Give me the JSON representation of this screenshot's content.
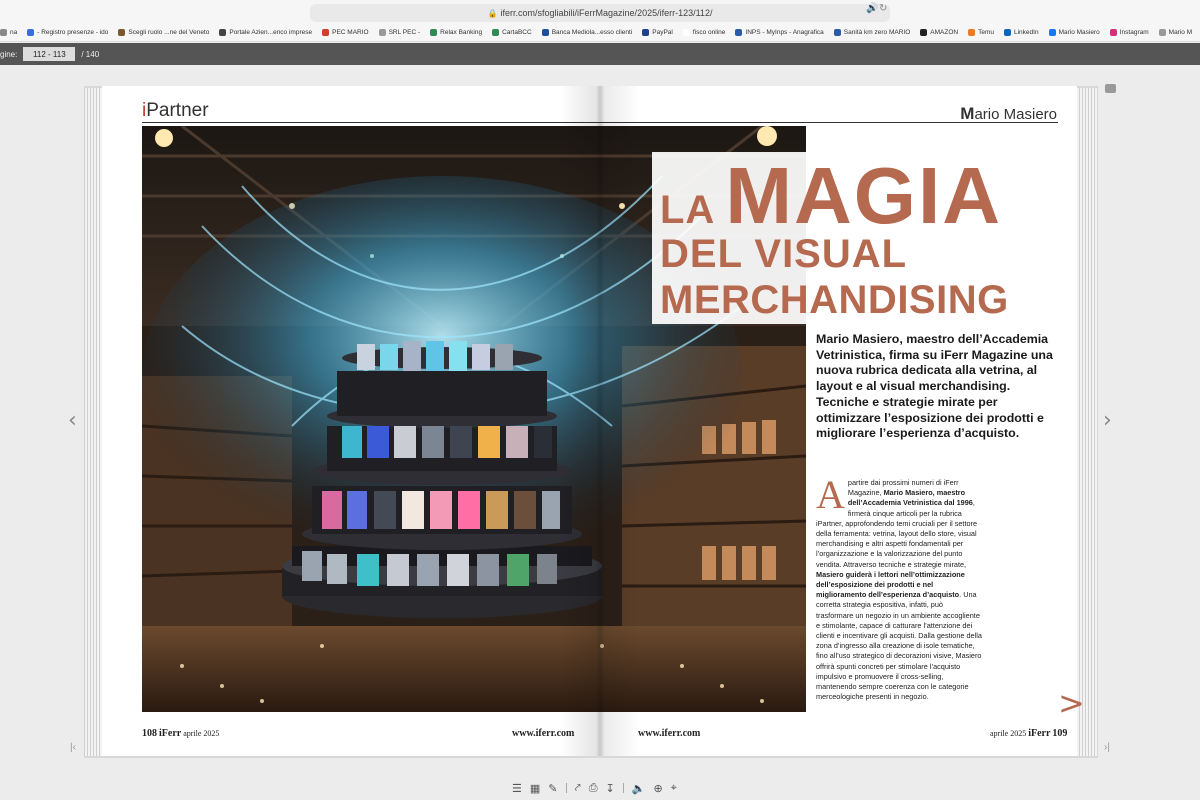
{
  "browser": {
    "url": "iferr.com/sfogliabili/iFerrMagazine/2025/iferr-123/112/",
    "bookmarks": [
      {
        "label": "na",
        "color": "#888888"
      },
      {
        "label": "- Registro presenze - ido",
        "color": "#3a6fd8"
      },
      {
        "label": "Scegli ruolo ...ne del Veneto",
        "color": "#7a5a2a"
      },
      {
        "label": "Portale Azien...enco imprese",
        "color": "#444444"
      },
      {
        "label": "PEC MARIO",
        "color": "#d63b2b"
      },
      {
        "label": "SRL PEC -",
        "color": "#999999"
      },
      {
        "label": "Relax Banking",
        "color": "#2e8b57"
      },
      {
        "label": "CartaBCC",
        "color": "#2e8b57"
      },
      {
        "label": "Banca Mediola...esso clienti",
        "color": "#1f4e9c"
      },
      {
        "label": "PayPal",
        "color": "#1f3f8f"
      },
      {
        "label": "fisco online",
        "color": "#ffffff"
      },
      {
        "label": "INPS - MyInps - Anagrafica",
        "color": "#2a5caa"
      },
      {
        "label": "Sanità km zero MARIO",
        "color": "#2a5caa"
      },
      {
        "label": "AMAZON",
        "color": "#222222"
      },
      {
        "label": "Temu",
        "color": "#f07a23"
      },
      {
        "label": "LinkedIn",
        "color": "#0a66c2"
      },
      {
        "label": "Mario Masiero",
        "color": "#1877f2"
      },
      {
        "label": "Instagram",
        "color": "#d6307a"
      },
      {
        "label": "Mario M",
        "color": "#999999"
      }
    ]
  },
  "viewer": {
    "page_label": "gine:",
    "page_value": "112 - 113",
    "page_total": "/ 140"
  },
  "magazine": {
    "brand_i": "i",
    "brand_rest": "Partner",
    "author_first_letter": "M",
    "author_rest": "ario Masiero",
    "title_la": "LA",
    "title_magia": "MAGIA",
    "title_line2": "DEL VISUAL",
    "title_line3": "MERCHANDISING",
    "lead": "Mario Masiero, maestro dell’Accademia Vetrinistica, firma su iFerr Magazine una nuova rubrica dedicata alla vetrina, al layout e al visual merchandising. Tecniche e strategie mirate per ottimizzare l’esposizione dei prodotti e migliorare l’esperienza d’acquisto.",
    "dropcap": "A",
    "body_1": "partire dai prossimi numeri di iFerr Magazine, ",
    "body_1b": "Mario Masiero, maestro dell’Accademia Vetrinistica dal 1996",
    "body_2": ", firmerà cinque articoli per la rubrica iPartner, approfondendo temi cruciali per il settore della ferramenta: vetrina, layout dello store, visual merchandising e altri aspetti fondamentali per l’organizzazione e la valorizzazione del punto vendita. Attraverso tecniche e strategie mirate, ",
    "body_2b": "Masiero guiderà i lettori nell’ottimizzazione dell’esposizione dei prodotti e nel miglioramento dell’esperienza d’acquisto",
    "body_3": ". Una corretta strategia espositiva, infatti, può trasformare un negozio in un ambiente accogliente e stimolante, capace di catturare l’attenzione dei clienti e incentivare gli acquisti. Dalla gestione della zona d’ingresso alla creazione di isole tematiche, fino all’uso strategico di decorazioni visive, Masiero offrirà spunti concreti per stimolare l’acquisto impulsivo e promuovere il cross-selling, mantenendo sempre coerenza con le categorie merceologiche presenti in negozio.",
    "next_arrow": ">",
    "folio_left_num": "108",
    "folio_left_brand": "iFerr",
    "folio_left_date": "aprile 2025",
    "folio_left_url": "www.iferr.com",
    "folio_right_url": "www.iferr.com",
    "folio_right_date": "aprile 2025",
    "folio_right_brand": "iFerr",
    "folio_right_num": "109"
  },
  "colors": {
    "title": "#b5694f",
    "viewer_bar": "#555555",
    "background": "#ececec"
  }
}
